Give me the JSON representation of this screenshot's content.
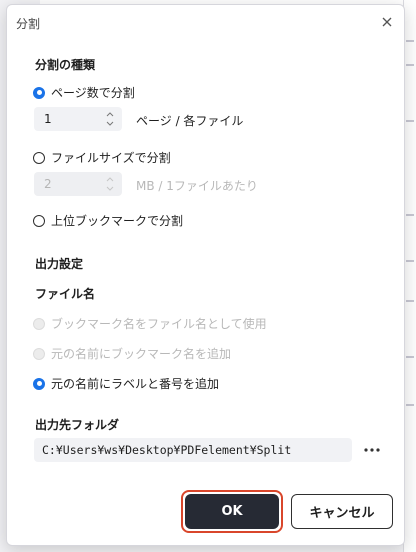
{
  "dialog": {
    "title": "分割",
    "close_icon": "close-icon"
  },
  "split_type": {
    "heading": "分割の種類",
    "options": [
      {
        "label": "ページ数で分割",
        "selected": true,
        "enabled": true
      },
      {
        "label": "ファイルサイズで分割",
        "selected": false,
        "enabled": true
      },
      {
        "label": "上位ブックマークで分割",
        "selected": false,
        "enabled": true
      }
    ],
    "pages_value": "1",
    "pages_unit": "ページ / 各ファイル",
    "size_value": "2",
    "size_unit": "MB / 1ファイルあたり"
  },
  "output": {
    "heading": "出力設定",
    "file_name_heading": "ファイル名",
    "file_name_options": [
      {
        "label": "ブックマーク名をファイル名として使用",
        "selected": false,
        "enabled": false
      },
      {
        "label": "元の名前にブックマーク名を追加",
        "selected": false,
        "enabled": false
      },
      {
        "label": "元の名前にラベルと番号を追加",
        "selected": true,
        "enabled": true
      }
    ],
    "folder_heading": "出力先フォルダ",
    "folder_path": "C:¥Users¥ws¥Desktop¥PDFelement¥Split",
    "more_icon": "more-icon"
  },
  "buttons": {
    "ok_label": "OK",
    "cancel_label": "キャンセル"
  },
  "colors": {
    "accent": "#1a73e8",
    "ok_background": "#262a34",
    "highlight_outline": "#d9462b"
  }
}
